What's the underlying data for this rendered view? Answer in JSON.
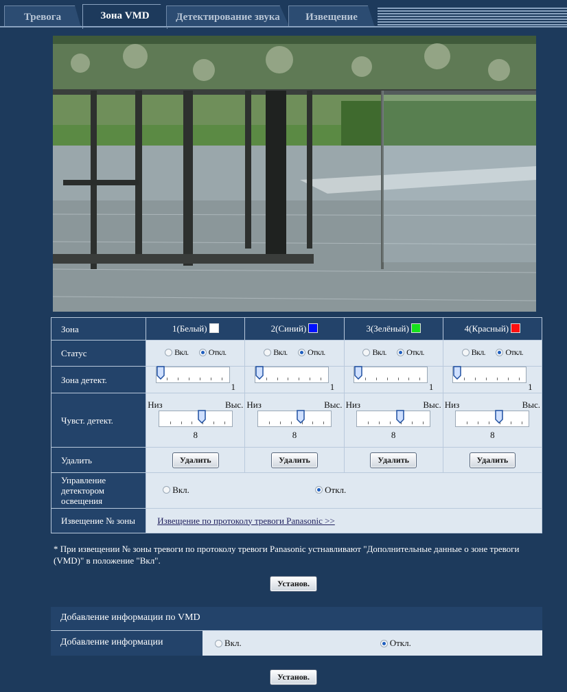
{
  "tabs": [
    {
      "label": "Тревога",
      "active": false
    },
    {
      "label": "Зона VMD",
      "active": true
    },
    {
      "label": "Детектирование звука",
      "active": false
    },
    {
      "label": "Извещение",
      "active": false
    }
  ],
  "table": {
    "zone_label": "Зона",
    "zones": [
      {
        "name": "1(Белый)",
        "color": "#ffffff"
      },
      {
        "name": "2(Синий)",
        "color": "#0010ff"
      },
      {
        "name": "3(Зелёный)",
        "color": "#16e01c"
      },
      {
        "name": "4(Красный)",
        "color": "#ff1010"
      }
    ],
    "status_label": "Статус",
    "status_on": "Вкл.",
    "status_off": "Откл.",
    "status_selected": "off",
    "detect_area_label": "Зона детект.",
    "detect_area_value": "1",
    "detect_area_level": 0,
    "sensitivity_label": "Чувст. детект.",
    "sensitivity_low": "Низ",
    "sensitivity_high": "Выс.",
    "sensitivity_value": "8",
    "sensitivity_level": 0.6,
    "delete_label": "Удалить",
    "delete_button": "Удалить",
    "light_control_label": "Управление детектором освещения",
    "light_on": "Вкл.",
    "light_off": "Откл.",
    "light_selected": "off",
    "notify_label": "Извещение № зоны",
    "notify_link": "Извещение по протоколу тревоги Panasonic >>"
  },
  "note": "* При извещении № зоны тревоги по протоколу тревоги Panasonic устнавливают \"Дополнительные данные о зоне тревоги (VMD)\" в положение \"Вкл\".",
  "set_button": "Установ.",
  "vmd_info": {
    "header": "Добавление информации по VMD",
    "row_label": "Добавление информации",
    "on": "Вкл.",
    "off": "Откл.",
    "selected": "off",
    "set_button": "Установ."
  }
}
